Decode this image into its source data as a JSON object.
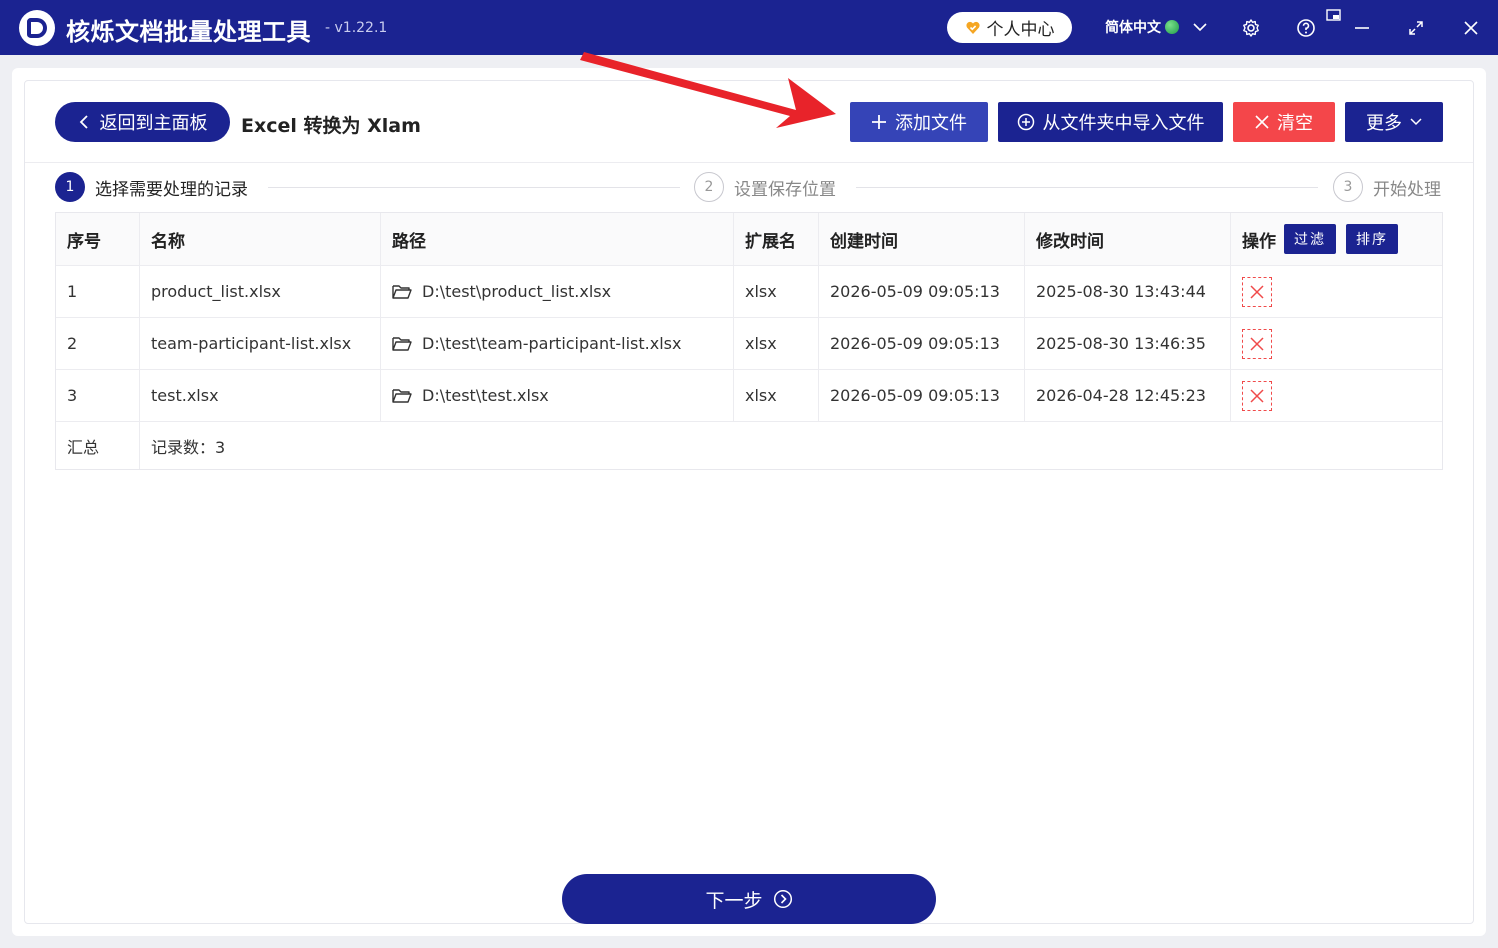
{
  "app": {
    "title": "核烁文档批量处理工具",
    "version": "- v1.22.1",
    "user_center": "个人中心",
    "language": "简体中文"
  },
  "header": {
    "back_label": "返回到主面板",
    "page_title": "Excel 转换为 Xlam",
    "add_file": "添加文件",
    "import_folder": "从文件夹中导入文件",
    "clear": "清空",
    "more": "更多"
  },
  "steps": [
    {
      "num": "1",
      "label": "选择需要处理的记录"
    },
    {
      "num": "2",
      "label": "设置保存位置"
    },
    {
      "num": "3",
      "label": "开始处理"
    }
  ],
  "table": {
    "columns": [
      "序号",
      "名称",
      "路径",
      "扩展名",
      "创建时间",
      "修改时间",
      "操作"
    ],
    "filter_label": "过滤",
    "sort_label": "排序",
    "rows": [
      {
        "index": "1",
        "name": "product_list.xlsx",
        "path": "D:\\test\\product_list.xlsx",
        "ext": "xlsx",
        "created": "2026-05-09 09:05:13",
        "modified": "2025-08-30 13:43:44"
      },
      {
        "index": "2",
        "name": "team-participant-list.xlsx",
        "path": "D:\\test\\team-participant-list.xlsx",
        "ext": "xlsx",
        "created": "2026-05-09 09:05:13",
        "modified": "2025-08-30 13:46:35"
      },
      {
        "index": "3",
        "name": "test.xlsx",
        "path": "D:\\test\\test.xlsx",
        "ext": "xlsx",
        "created": "2026-05-09 09:05:13",
        "modified": "2026-04-28 12:45:23"
      }
    ],
    "summary_label": "汇总",
    "summary_value": "记录数：3"
  },
  "footer": {
    "next_label": "下一步"
  },
  "colors": {
    "primary": "#1b2391",
    "add_button": "#3544b7",
    "danger": "#f4464a",
    "annotation_arrow": "#e8232a"
  },
  "icons": [
    "app-logo-icon",
    "heart-badge-icon",
    "globe-icon",
    "chevron-down-icon",
    "gear-icon",
    "help-icon",
    "mini-mode-icon",
    "minimize-icon",
    "maximize-icon",
    "close-icon",
    "chevron-left-icon",
    "plus-icon",
    "circle-plus-icon",
    "x-icon",
    "folder-icon",
    "delete-icon",
    "circle-arrow-right-icon"
  ]
}
